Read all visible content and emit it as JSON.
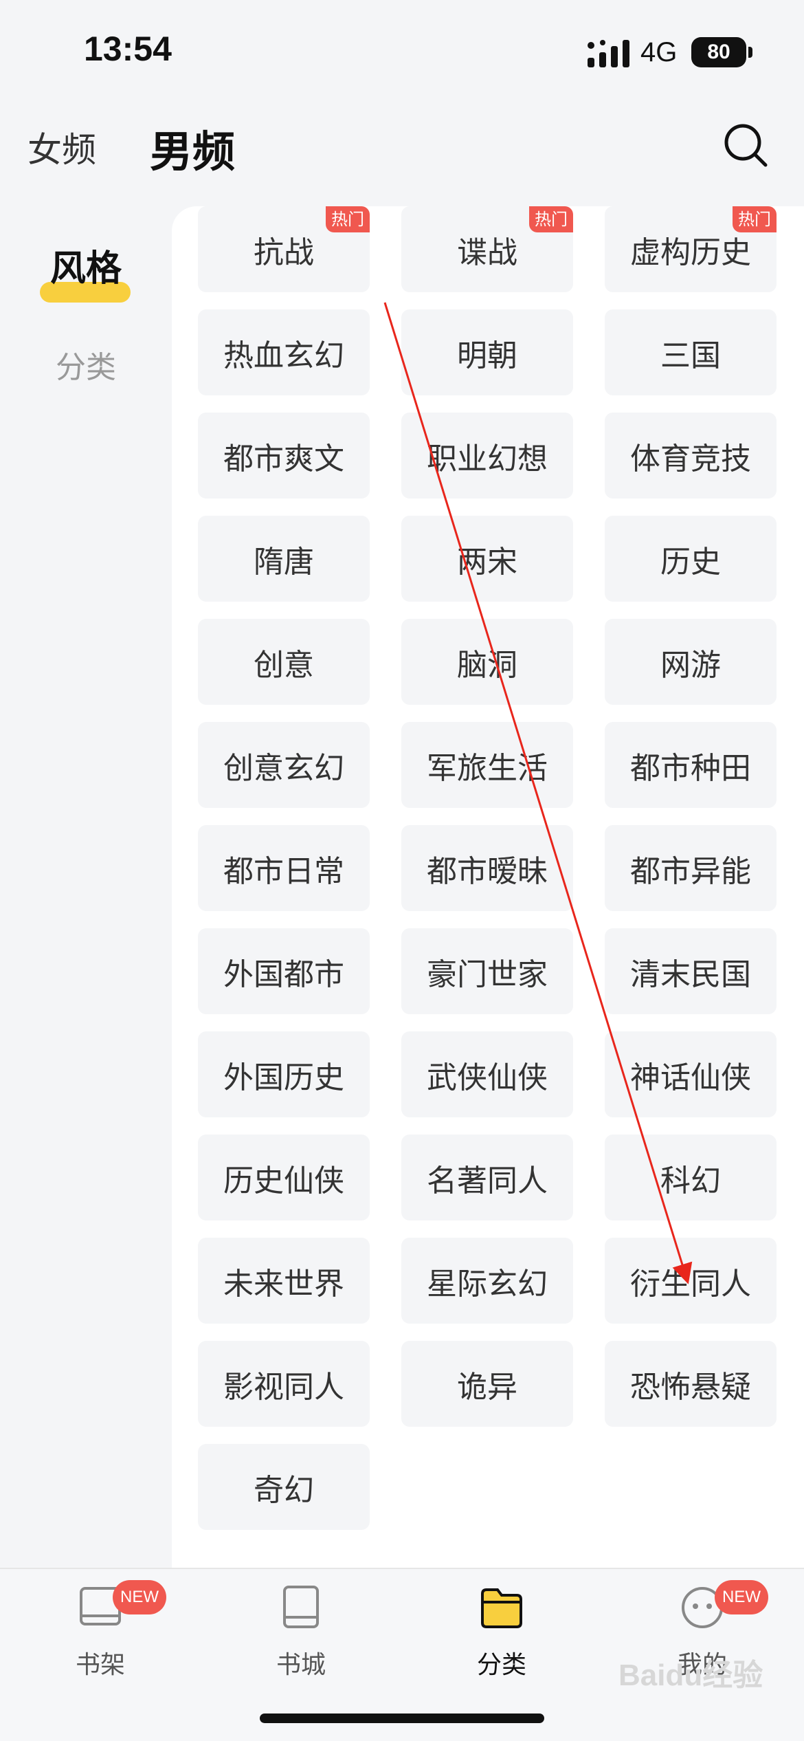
{
  "status_bar": {
    "time": "13:54",
    "network": "4G",
    "battery": "80"
  },
  "header": {
    "tab_female": "女频",
    "tab_male": "男频"
  },
  "sidebar": {
    "style_label": "风格",
    "category_label": "分类"
  },
  "hot_badge": "热门",
  "grid": [
    {
      "label": "",
      "hot": false
    },
    {
      "label": "",
      "hot": false
    },
    {
      "label": "",
      "hot": false
    },
    {
      "label": "抗战",
      "hot": true
    },
    {
      "label": "谍战",
      "hot": true
    },
    {
      "label": "虚构历史",
      "hot": true
    },
    {
      "label": "热血玄幻",
      "hot": false
    },
    {
      "label": "明朝",
      "hot": false
    },
    {
      "label": "三国",
      "hot": false
    },
    {
      "label": "都市爽文",
      "hot": false
    },
    {
      "label": "职业幻想",
      "hot": false
    },
    {
      "label": "体育竞技",
      "hot": false
    },
    {
      "label": "隋唐",
      "hot": false
    },
    {
      "label": "两宋",
      "hot": false
    },
    {
      "label": "历史",
      "hot": false
    },
    {
      "label": "创意",
      "hot": false
    },
    {
      "label": "脑洞",
      "hot": false
    },
    {
      "label": "网游",
      "hot": false
    },
    {
      "label": "创意玄幻",
      "hot": false
    },
    {
      "label": "军旅生活",
      "hot": false
    },
    {
      "label": "都市种田",
      "hot": false
    },
    {
      "label": "都市日常",
      "hot": false
    },
    {
      "label": "都市暧昧",
      "hot": false
    },
    {
      "label": "都市异能",
      "hot": false
    },
    {
      "label": "外国都市",
      "hot": false
    },
    {
      "label": "豪门世家",
      "hot": false
    },
    {
      "label": "清末民国",
      "hot": false
    },
    {
      "label": "外国历史",
      "hot": false
    },
    {
      "label": "武侠仙侠",
      "hot": false
    },
    {
      "label": "神话仙侠",
      "hot": false
    },
    {
      "label": "历史仙侠",
      "hot": false
    },
    {
      "label": "名著同人",
      "hot": false
    },
    {
      "label": "科幻",
      "hot": false
    },
    {
      "label": "未来世界",
      "hot": false
    },
    {
      "label": "星际玄幻",
      "hot": false
    },
    {
      "label": "衍生同人",
      "hot": false
    },
    {
      "label": "影视同人",
      "hot": false
    },
    {
      "label": "诡异",
      "hot": false
    },
    {
      "label": "恐怖悬疑",
      "hot": false
    },
    {
      "label": "奇幻",
      "hot": false
    }
  ],
  "bottom_nav": {
    "bookshelf": "书架",
    "bookstore": "书城",
    "category": "分类",
    "mine": "我的",
    "new_badge": "NEW"
  },
  "watermark": "Baidu经验",
  "colors": {
    "accent_yellow": "#f8cf3e",
    "hot_red": "#f0584f",
    "arrow_red": "#e8261c"
  }
}
